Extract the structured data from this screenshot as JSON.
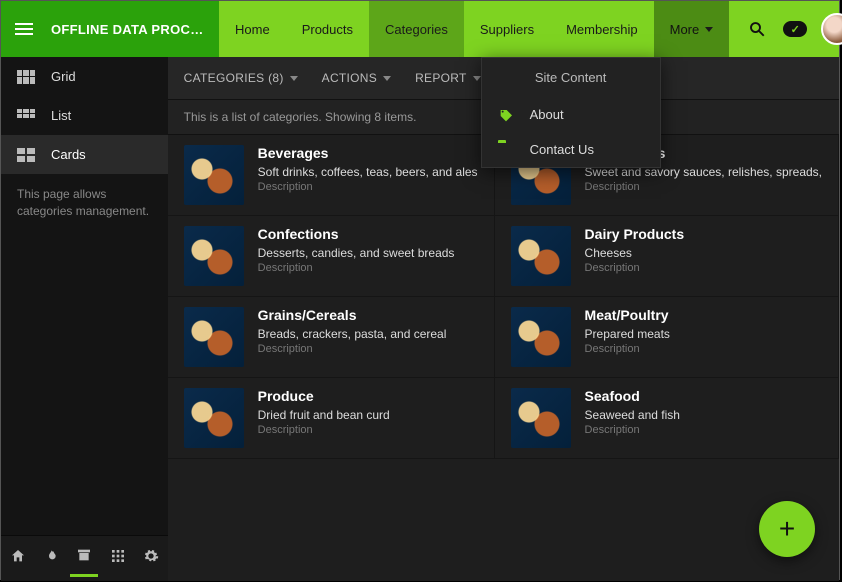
{
  "brand": "OFFLINE DATA PROCESS...",
  "nav": {
    "items": [
      "Home",
      "Products",
      "Categories",
      "Suppliers",
      "Membership"
    ],
    "more": "More",
    "active_index": 2
  },
  "sidebar": {
    "items": [
      {
        "label": "Grid"
      },
      {
        "label": "List"
      },
      {
        "label": "Cards"
      }
    ],
    "active_index": 2,
    "hint": "This page allows categories management."
  },
  "toolbar": {
    "categories_label": "CATEGORIES (8)",
    "actions_label": "ACTIONS",
    "report_label": "REPORT"
  },
  "list_hint": "This is a list of categories. Showing 8 items.",
  "dropdown": {
    "title": "Site Content",
    "items": [
      {
        "icon": "price-tag-icon",
        "label": "About"
      },
      {
        "icon": "folder-icon",
        "label": "Contact Us"
      }
    ]
  },
  "meta_label": "Description",
  "categories": [
    {
      "name": "Beverages",
      "desc": "Soft drinks, coffees, teas, beers, and ales"
    },
    {
      "name": "Condiments",
      "desc": "Sweet and savory sauces, relishes, spreads,"
    },
    {
      "name": "Confections",
      "desc": "Desserts, candies, and sweet breads"
    },
    {
      "name": "Dairy Products",
      "desc": "Cheeses"
    },
    {
      "name": "Grains/Cereals",
      "desc": "Breads, crackers, pasta, and cereal"
    },
    {
      "name": "Meat/Poultry",
      "desc": "Prepared meats"
    },
    {
      "name": "Produce",
      "desc": "Dried fruit and bean curd"
    },
    {
      "name": "Seafood",
      "desc": "Seaweed and fish"
    }
  ],
  "fab_label": "+",
  "colors": {
    "accent": "#7ED321",
    "accent_dark": "#2BA20B"
  }
}
